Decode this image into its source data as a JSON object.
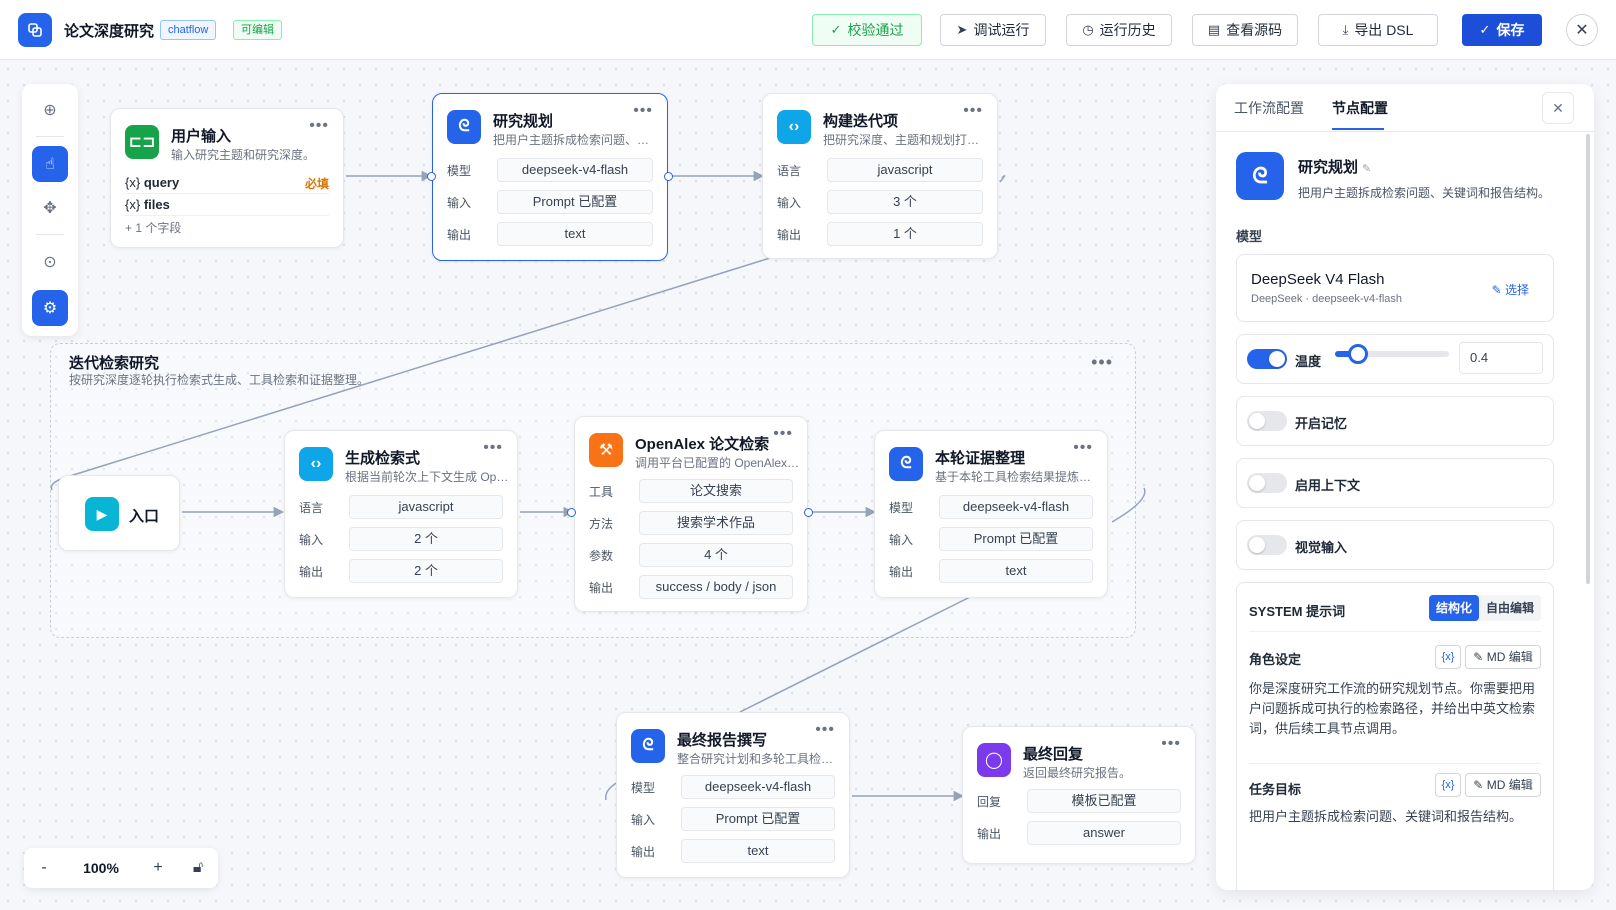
{
  "header": {
    "title": "论文深度研究",
    "badge_type": "chatflow",
    "badge_edit": "可编辑",
    "validate_label": "校验通过",
    "debug_label": "调试运行",
    "history_label": "运行历史",
    "source_label": "查看源码",
    "export_label": "导出 DSL",
    "save_label": "保存"
  },
  "zoom": {
    "minus": "-",
    "value": "100%",
    "plus": "+"
  },
  "group": {
    "title": "迭代检索研究",
    "desc": "按研究深度逐轮执行检索式生成、工具检索和证据整理。"
  },
  "nodes": {
    "user_input": {
      "title": "用户输入",
      "desc": "输入研究主题和研究深度。",
      "field1": "query",
      "field1_prefix": "{x}",
      "required": "必填",
      "field2": "files",
      "field2_prefix": "{x}",
      "more_fields": "+ 1 个字段"
    },
    "plan": {
      "title": "研究规划",
      "desc": "把用户主题拆成检索问题、关键词和报告结构。",
      "r1l": "模型",
      "r1v": "deepseek-v4-flash",
      "r2l": "输入",
      "r2v": "Prompt 已配置",
      "r3l": "输出",
      "r3v": "text"
    },
    "build_iter": {
      "title": "构建迭代项",
      "desc": "把研究深度、主题和规划打包成迭代项。",
      "r1l": "语言",
      "r1v": "javascript",
      "r2l": "输入",
      "r2v": "3 个",
      "r3l": "输出",
      "r3v": "1 个"
    },
    "entry": {
      "title": "入口"
    },
    "gen_query": {
      "title": "生成检索式",
      "desc": "根据当前轮次上下文生成 OpenAlex 检索式。",
      "r1l": "语言",
      "r1v": "javascript",
      "r2l": "输入",
      "r2v": "2 个",
      "r3l": "输出",
      "r3v": "2 个"
    },
    "openalex": {
      "title": "OpenAlex 论文检索",
      "desc": "调用平台已配置的 OpenAlex 工具。",
      "r1l": "工具",
      "r1v": "论文搜索",
      "r2l": "方法",
      "r2v": "搜索学术作品",
      "r3l": "参数",
      "r3v": "4 个",
      "r4l": "输出",
      "r4v": "success / body / json"
    },
    "evidence": {
      "title": "本轮证据整理",
      "desc": "基于本轮工具检索结果提炼证据。",
      "r1l": "模型",
      "r1v": "deepseek-v4-flash",
      "r2l": "输入",
      "r2v": "Prompt 已配置",
      "r3l": "输出",
      "r3v": "text"
    },
    "final_report": {
      "title": "最终报告撰写",
      "desc": "整合研究计划和多轮工具检索证据。",
      "r1l": "模型",
      "r1v": "deepseek-v4-flash",
      "r2l": "输入",
      "r2v": "Prompt 已配置",
      "r3l": "输出",
      "r3v": "text"
    },
    "final_answer": {
      "title": "最终回复",
      "desc": "返回最终研究报告。",
      "r1l": "回复",
      "r1v": "模板已配置",
      "r2l": "输出",
      "r2v": "answer"
    }
  },
  "panel": {
    "tab_workflow": "工作流配置",
    "tab_node": "节点配置",
    "node_title": "研究规划",
    "node_desc": "把用户主题拆成检索问题、关键词和报告结构。",
    "model_label": "模型",
    "model_name": "DeepSeek V4 Flash",
    "model_sub": "DeepSeek · deepseek-v4-flash",
    "model_pick": "选择",
    "temperature_label": "温度",
    "temperature_value": "0.4",
    "temperature_fraction": 0.2,
    "memory_label": "开启记忆",
    "context_label": "启用上下文",
    "vision_label": "视觉输入",
    "system_label": "SYSTEM 提示词",
    "mode_structured": "结构化",
    "mode_free": "自由编辑",
    "role_label": "角色设定",
    "role_text": "你是深度研究工作流的研究规划节点。你需要把用户问题拆成可执行的检索路径，并给出中英文检索词，供后续工具节点调用。",
    "goal_label": "任务目标",
    "goal_text": "把用户主题拆成检索问题、关键词和报告结构。",
    "var_label": "{x}",
    "md_label": "MD 编辑"
  },
  "colors": {
    "accent": "#2563eb",
    "success": "#16a34a",
    "required": "#d97706",
    "edge": "#94a3b8"
  }
}
